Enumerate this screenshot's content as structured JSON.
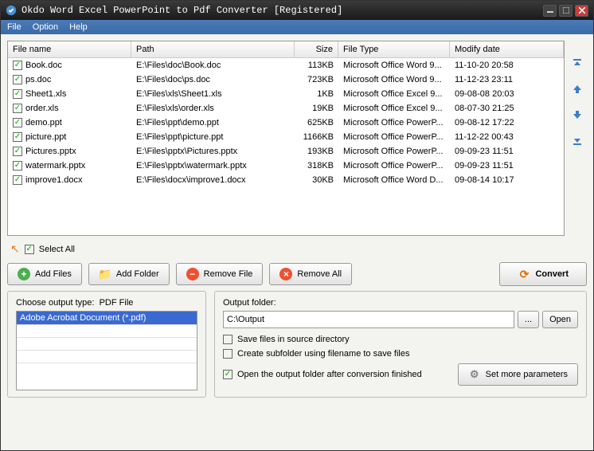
{
  "title": "Okdo Word Excel PowerPoint to Pdf Converter [Registered]",
  "menu": {
    "file": "File",
    "option": "Option",
    "help": "Help"
  },
  "headers": {
    "name": "File name",
    "path": "Path",
    "size": "Size",
    "type": "File Type",
    "date": "Modify date"
  },
  "rows": [
    {
      "name": "Book.doc",
      "path": "E:\\Files\\doc\\Book.doc",
      "size": "113KB",
      "type": "Microsoft Office Word 9...",
      "date": "11-10-20 20:58"
    },
    {
      "name": "ps.doc",
      "path": "E:\\Files\\doc\\ps.doc",
      "size": "723KB",
      "type": "Microsoft Office Word 9...",
      "date": "11-12-23 23:11"
    },
    {
      "name": "Sheet1.xls",
      "path": "E:\\Files\\xls\\Sheet1.xls",
      "size": "1KB",
      "type": "Microsoft Office Excel 9...",
      "date": "09-08-08 20:03"
    },
    {
      "name": "order.xls",
      "path": "E:\\Files\\xls\\order.xls",
      "size": "19KB",
      "type": "Microsoft Office Excel 9...",
      "date": "08-07-30 21:25"
    },
    {
      "name": "demo.ppt",
      "path": "E:\\Files\\ppt\\demo.ppt",
      "size": "625KB",
      "type": "Microsoft Office PowerP...",
      "date": "09-08-12 17:22"
    },
    {
      "name": "picture.ppt",
      "path": "E:\\Files\\ppt\\picture.ppt",
      "size": "1166KB",
      "type": "Microsoft Office PowerP...",
      "date": "11-12-22 00:43"
    },
    {
      "name": "Pictures.pptx",
      "path": "E:\\Files\\pptx\\Pictures.pptx",
      "size": "193KB",
      "type": "Microsoft Office PowerP...",
      "date": "09-09-23 11:51"
    },
    {
      "name": "watermark.pptx",
      "path": "E:\\Files\\pptx\\watermark.pptx",
      "size": "318KB",
      "type": "Microsoft Office PowerP...",
      "date": "09-09-23 11:51"
    },
    {
      "name": "improve1.docx",
      "path": "E:\\Files\\docx\\improve1.docx",
      "size": "30KB",
      "type": "Microsoft Office Word D...",
      "date": "09-08-14 10:17"
    }
  ],
  "select_all": "Select All",
  "buttons": {
    "add_files": "Add Files",
    "add_folder": "Add Folder",
    "remove_file": "Remove File",
    "remove_all": "Remove All",
    "convert": "Convert",
    "browse": "...",
    "open": "Open",
    "more": "Set more parameters"
  },
  "output_type": {
    "label": "Choose output type:",
    "current": "PDF File",
    "selected": "Adobe Acrobat Document (*.pdf)"
  },
  "output_folder": {
    "label": "Output folder:",
    "value": "C:\\Output"
  },
  "options": {
    "save_source": "Save files in source directory",
    "create_sub": "Create subfolder using filename to save files",
    "open_after": "Open the output folder after conversion finished"
  }
}
